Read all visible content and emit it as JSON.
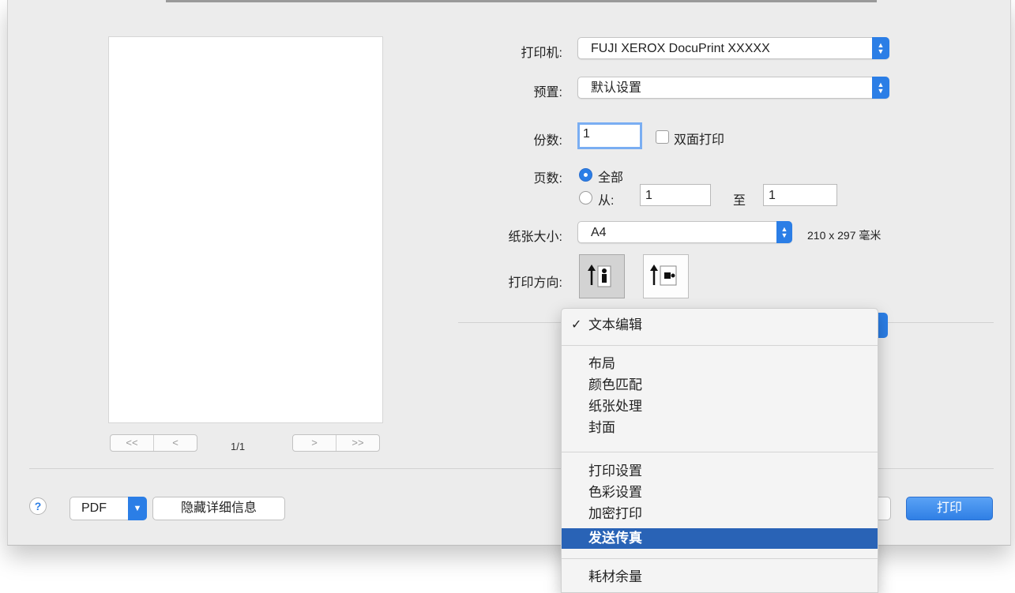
{
  "printer": {
    "label": "打印机:",
    "value": "FUJI XEROX DocuPrint XXXXX"
  },
  "presets": {
    "label": "预置:",
    "value": "默认设置"
  },
  "copies": {
    "label": "份数:",
    "value": "1",
    "duplex_label": "双面打印",
    "duplex_checked": false
  },
  "pages": {
    "label": "页数:",
    "all_label": "全部",
    "from_label": "从:",
    "from_value": "1",
    "to_label": "至",
    "to_value": "1",
    "selected": "all"
  },
  "paper_size": {
    "label": "纸张大小:",
    "value": "A4",
    "dimensions": "210 x 297 毫米"
  },
  "orientation": {
    "label": "打印方向:",
    "selected": "portrait"
  },
  "preview": {
    "page_counter": "1/1",
    "first_label": "<<",
    "prev_label": "<",
    "next_label": ">",
    "last_label": ">>"
  },
  "bottom_bar": {
    "help_label": "?",
    "pdf_label": "PDF",
    "hide_details_label": "隐藏详细信息",
    "print_label": "打印"
  },
  "menu": {
    "groups": [
      [
        {
          "label": "文本编辑",
          "checked": true
        }
      ],
      [
        {
          "label": "布局"
        },
        {
          "label": "颜色匹配"
        },
        {
          "label": "纸张处理"
        },
        {
          "label": "封面"
        }
      ],
      [
        {
          "label": "打印设置"
        },
        {
          "label": "色彩设置"
        },
        {
          "label": "加密打印"
        },
        {
          "label": "发送传真",
          "highlighted": true
        }
      ],
      [
        {
          "label": "耗材余量"
        }
      ]
    ]
  },
  "colors": {
    "accent": "#2b7ee6",
    "highlight": "#2963b6",
    "dialog_bg": "#ececec"
  },
  "icons": {
    "checkmark": "✓",
    "popup_arrows": "up-down-arrows",
    "chevron": "chevron-down"
  }
}
